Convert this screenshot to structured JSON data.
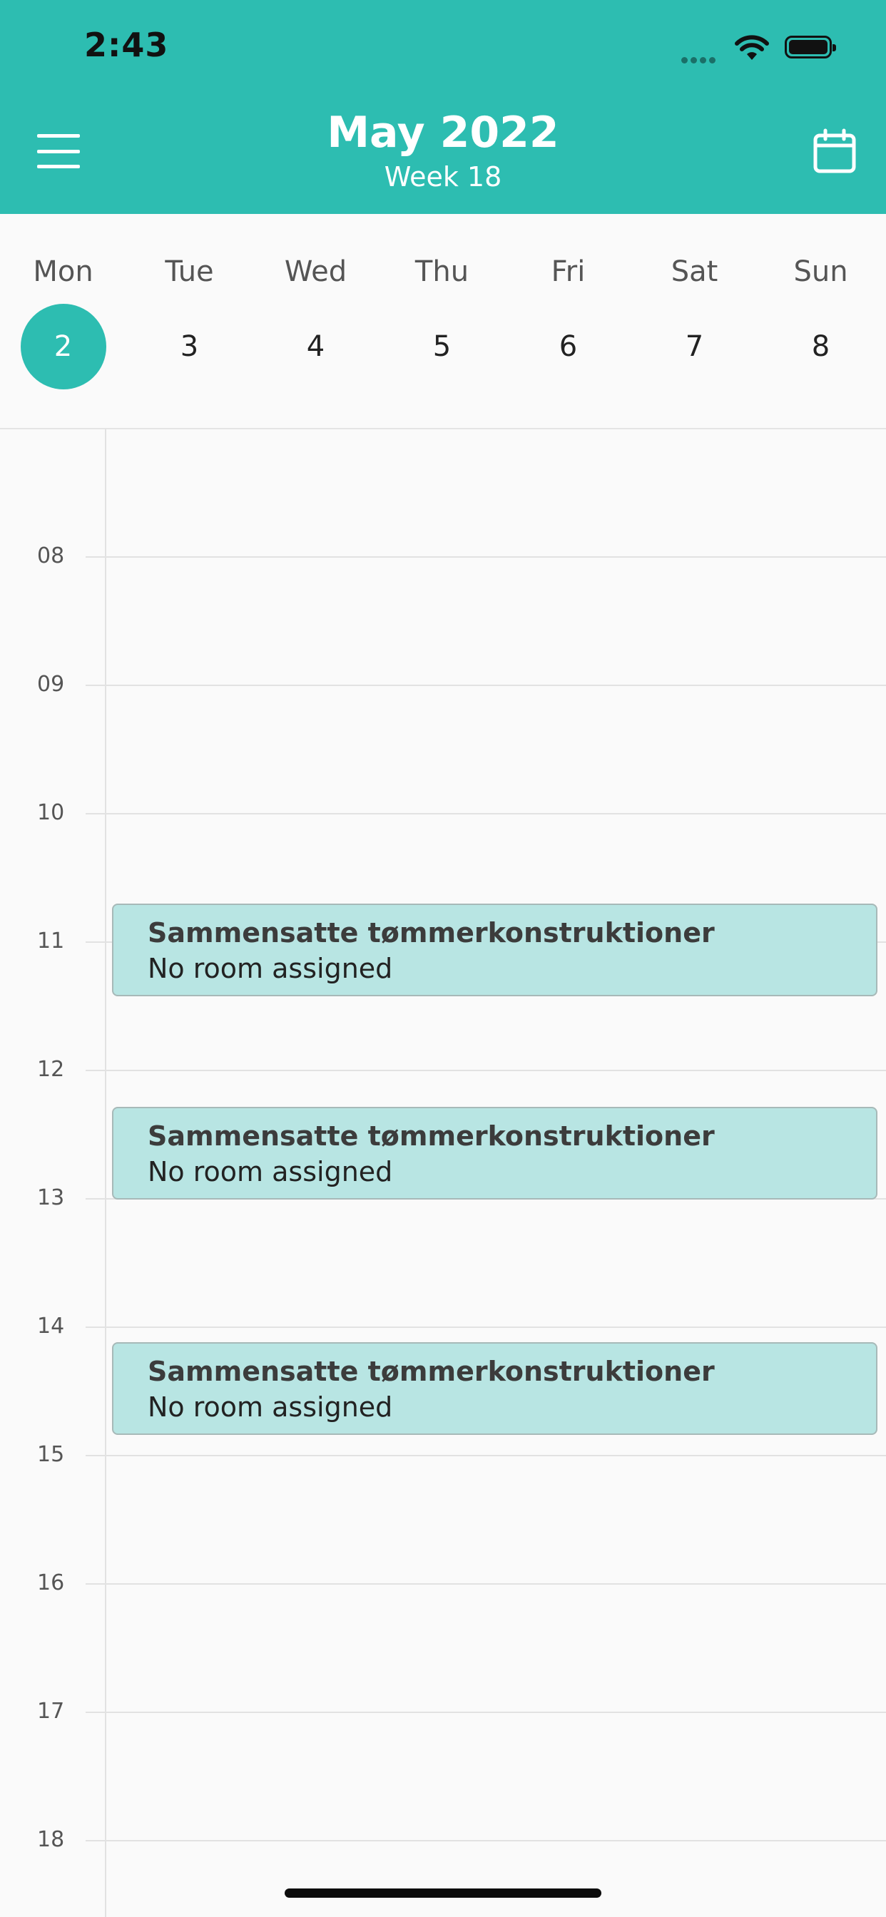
{
  "status_bar": {
    "time": "2:43"
  },
  "header": {
    "title": "May 2022",
    "subtitle": "Week 18",
    "menu_icon": "hamburger-menu-icon",
    "calendar_icon": "calendar-icon",
    "background_color": "#2dbdb1"
  },
  "week": {
    "days": [
      {
        "name": "Mon",
        "number": "2",
        "selected": true
      },
      {
        "name": "Tue",
        "number": "3",
        "selected": false
      },
      {
        "name": "Wed",
        "number": "4",
        "selected": false
      },
      {
        "name": "Thu",
        "number": "5",
        "selected": false
      },
      {
        "name": "Fri",
        "number": "6",
        "selected": false
      },
      {
        "name": "Sat",
        "number": "7",
        "selected": false
      },
      {
        "name": "Sun",
        "number": "8",
        "selected": false
      }
    ],
    "accent_color": "#2dbdb1"
  },
  "hours": [
    "08",
    "09",
    "10",
    "11",
    "12",
    "13",
    "14",
    "15",
    "16",
    "17",
    "18"
  ],
  "events": [
    {
      "title": "Sammensatte tømmerkonstruktioner",
      "room": "No room assigned"
    },
    {
      "title": "Sammensatte tømmerkonstruktioner",
      "room": "No room assigned"
    },
    {
      "title": "Sammensatte tømmerkonstruktioner",
      "room": "No room assigned"
    }
  ],
  "event_color": "#b8e5e3"
}
